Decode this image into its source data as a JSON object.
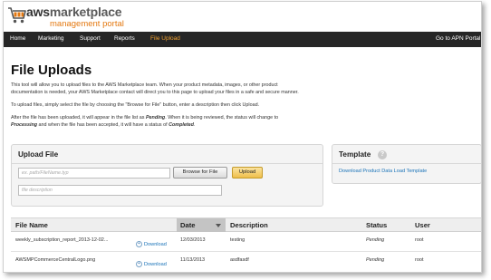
{
  "brand": {
    "aws_part": "aws",
    "marketplace_part": "marketplace",
    "subtitle": "management portal"
  },
  "nav": {
    "items": [
      {
        "label": "Home"
      },
      {
        "label": "Marketing"
      },
      {
        "label": "Support"
      },
      {
        "label": "Reports"
      },
      {
        "label": "File Upload"
      }
    ],
    "right_link": "Go to APN Portal"
  },
  "page": {
    "title": "File Uploads",
    "intro": [
      "This tool will allow you to upload files to the AWS Marketplace team. When your product metadata, images, or other product",
      "documentation is needed, your AWS Marketplace contact will direct you to this page to upload your files in a safe and secure manner.",
      "To upload files, simply select the file by choosing the \"Browse for File\" button, enter a description then click Upload."
    ],
    "status_line1_a": "After the file has been uploaded, it will appear in the file list as ",
    "status_pending": "Pending",
    "status_line1_b": ". When it is being reviewed, the status will change to",
    "status_processing": "Processing",
    "status_line2_b": " and when the file has been accepted, it will have a status of ",
    "status_completed": "Completed",
    "status_line2_c": "."
  },
  "upload": {
    "title": "Upload File",
    "path_placeholder": "ex. path/FileName.typ",
    "description_placeholder": "file description",
    "browse_label": "Browse for File",
    "upload_label": "Upload"
  },
  "template": {
    "title": "Template",
    "help_glyph": "?",
    "link_label": "Download Product Data Load Template"
  },
  "files_table": {
    "columns": [
      "File Name",
      "Date",
      "Description",
      "Status",
      "User"
    ],
    "download_label": "Download",
    "rows": [
      {
        "file_name": "weekly_subscription_report_2013-12-02...",
        "date": "12/03/2013",
        "description": "testing",
        "status": "Pending",
        "user": "root"
      },
      {
        "file_name": "AWSMPCommerceCentralLogo.png",
        "date": "11/13/2013",
        "description": "asdfasdf",
        "status": "Pending",
        "user": "root"
      }
    ]
  }
}
